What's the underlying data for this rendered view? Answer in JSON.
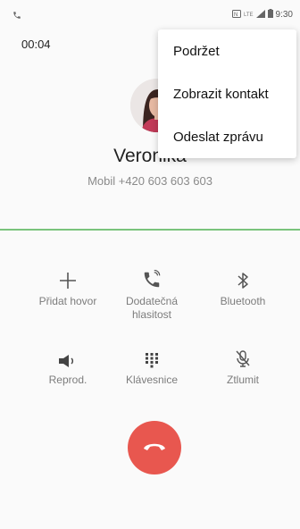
{
  "status_bar": {
    "time": "9:30",
    "network": "LTE"
  },
  "call": {
    "timer": "00:04",
    "caller_name": "Veronika",
    "number_line": "Mobil  +420 603 603 603"
  },
  "controls": [
    {
      "label": "Přidat hovor",
      "icon": "plus-icon"
    },
    {
      "label": "Dodatečná hlasitost",
      "icon": "extra-volume-icon"
    },
    {
      "label": "Bluetooth",
      "icon": "bluetooth-icon"
    },
    {
      "label": "Reprod.",
      "icon": "speaker-icon"
    },
    {
      "label": "Klávesnice",
      "icon": "keypad-icon"
    },
    {
      "label": "Ztlumit",
      "icon": "mute-icon"
    }
  ],
  "menu": {
    "items": [
      {
        "label": "Podržet"
      },
      {
        "label": "Zobrazit kontakt"
      },
      {
        "label": "Odeslat zprávu"
      }
    ]
  },
  "colors": {
    "accent": "#79c37c",
    "end_call": "#e8574f"
  }
}
